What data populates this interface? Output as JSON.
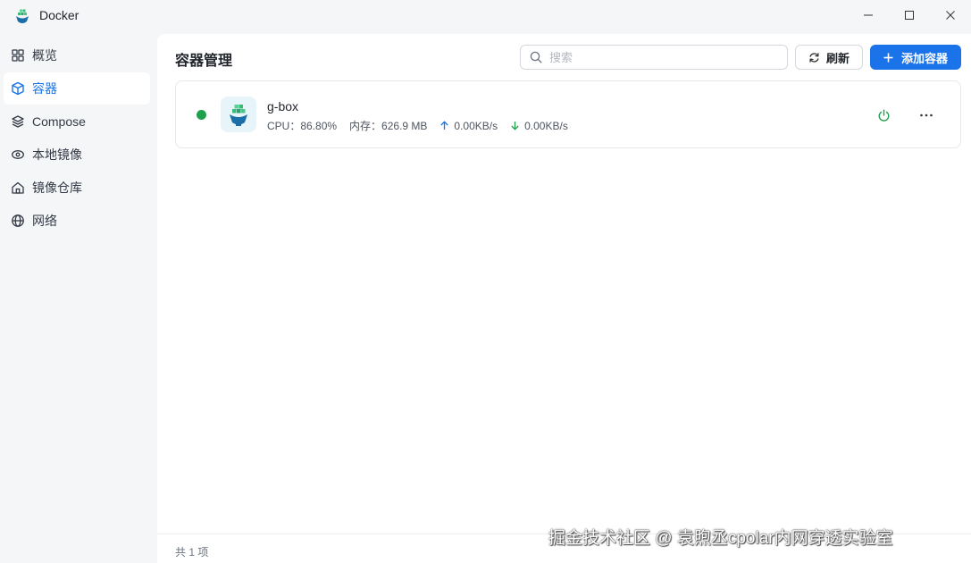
{
  "window": {
    "title": "Docker"
  },
  "sidebar": {
    "items": [
      {
        "label": "概览",
        "icon": "grid-icon",
        "active": false
      },
      {
        "label": "容器",
        "icon": "cube-icon",
        "active": true
      },
      {
        "label": "Compose",
        "icon": "layers-icon",
        "active": false
      },
      {
        "label": "本地镜像",
        "icon": "eye-disc-icon",
        "active": false
      },
      {
        "label": "镜像仓库",
        "icon": "home-icon",
        "active": false
      },
      {
        "label": "网络",
        "icon": "globe-icon",
        "active": false
      }
    ]
  },
  "main": {
    "title": "容器管理",
    "search_placeholder": "搜索",
    "refresh_label": "刷新",
    "add_label": "添加容器",
    "accent_color": "#1a73e8"
  },
  "containers": [
    {
      "name": "g-box",
      "status_color": "#1fa14b",
      "cpu": "CPU：86.80%",
      "memory": "内存：626.9 MB",
      "upload": "0.00KB/s",
      "download": "0.00KB/s"
    }
  ],
  "footer": {
    "total": "共 1 项"
  },
  "watermark": "掘金技术社区 @ 袁煦丞cpolar内网穿透实验室"
}
